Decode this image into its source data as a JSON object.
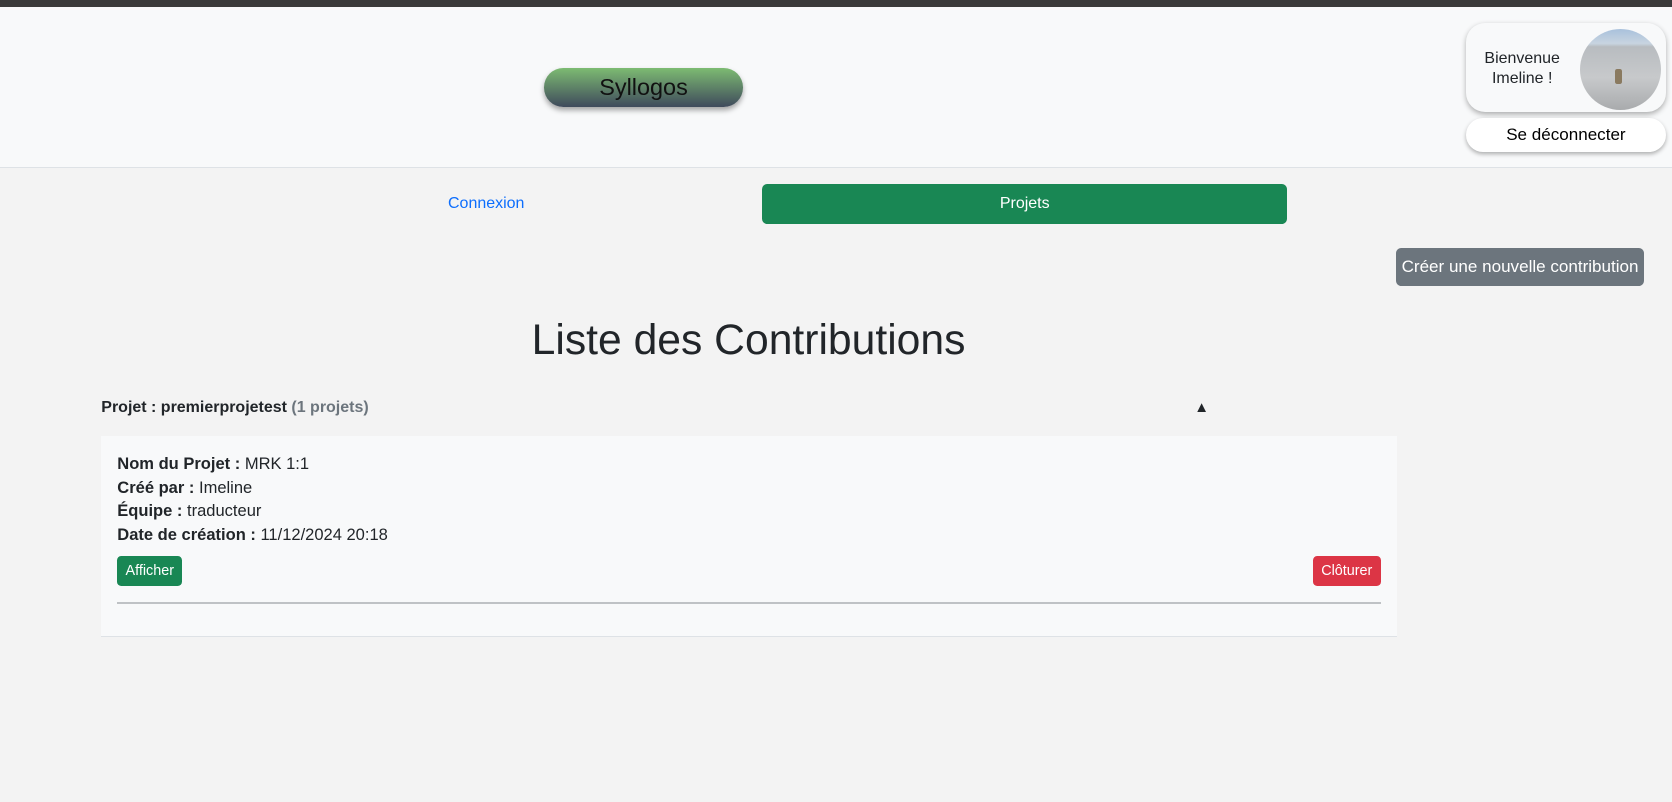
{
  "header": {
    "brand": "Syllogos",
    "welcome_line1": "Bienvenue",
    "welcome_line2": "Imeline !",
    "logout_label": "Se déconnecter"
  },
  "nav": {
    "items": [
      {
        "label": "Connexion",
        "active": false
      },
      {
        "label": "Projets",
        "active": true
      }
    ]
  },
  "actions": {
    "create_label": "Créer une nouvelle contribution"
  },
  "main": {
    "title": "Liste des Contributions",
    "group": {
      "label": "Projet : premierprojetest",
      "count": "(1 projets)",
      "toggle": "▲",
      "contributions": [
        {
          "fields": [
            {
              "label": "Nom du Projet :",
              "value": "MRK 1:1"
            },
            {
              "label": "Créé par :",
              "value": "Imeline"
            },
            {
              "label": "Équipe :",
              "value": "traducteur"
            },
            {
              "label": "Date de création :",
              "value": "11/12/2024 20:18"
            }
          ],
          "view_label": "Afficher",
          "close_label": "Clôturer"
        }
      ]
    }
  },
  "colors": {
    "primary_green": "#198754",
    "danger": "#dc3545",
    "secondary": "#6c757d",
    "link": "#0d6efd"
  }
}
